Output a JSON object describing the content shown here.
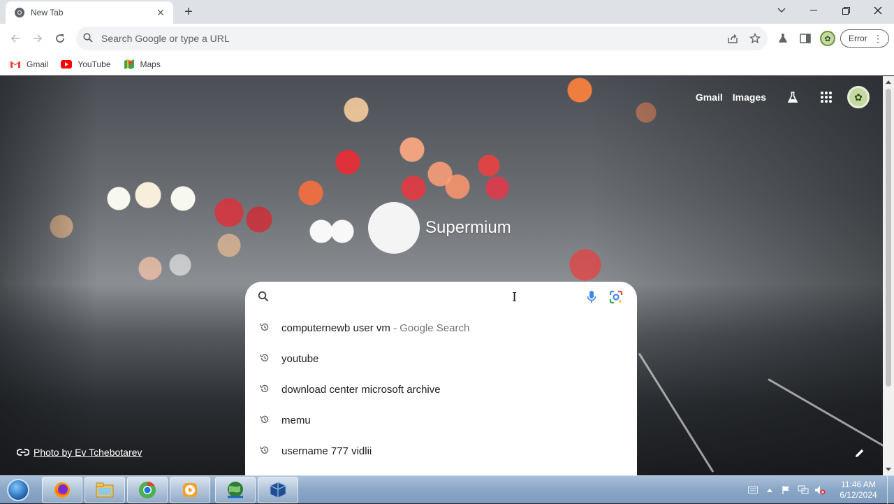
{
  "window": {
    "tab_title": "New Tab"
  },
  "toolbar": {
    "omnibox_placeholder": "Search Google or type a URL",
    "error_label": "Error"
  },
  "bookmarks": [
    {
      "label": "Gmail",
      "icon": "gmail-icon"
    },
    {
      "label": "YouTube",
      "icon": "youtube-icon"
    },
    {
      "label": "Maps",
      "icon": "maps-icon"
    }
  ],
  "ntp": {
    "top_links": {
      "gmail": "Gmail",
      "images": "Images"
    },
    "logo_text": "Supermium",
    "search_placeholder": "",
    "suggestions": [
      {
        "text": "computernewb user vm",
        "suffix": " - Google Search"
      },
      {
        "text": "youtube",
        "suffix": ""
      },
      {
        "text": "download center microsoft archive",
        "suffix": ""
      },
      {
        "text": "memu",
        "suffix": ""
      },
      {
        "text": "username 777 vidlii",
        "suffix": ""
      }
    ],
    "photo_credit": "Photo by Ev Tchebotarev"
  },
  "taskbar": {
    "clock_time": "11:46 AM",
    "clock_date": "6/12/2024",
    "apps": [
      "firefox-icon",
      "file-explorer-icon",
      "chrome-icon",
      "media-player-icon",
      "internet-download-icon",
      "virtualbox-icon"
    ]
  },
  "colors": {
    "accent_blue": "#4285f4",
    "gmail_red": "#ea4335",
    "youtube_red": "#ff0000",
    "taskbar_blue": "#8aa6c6"
  }
}
